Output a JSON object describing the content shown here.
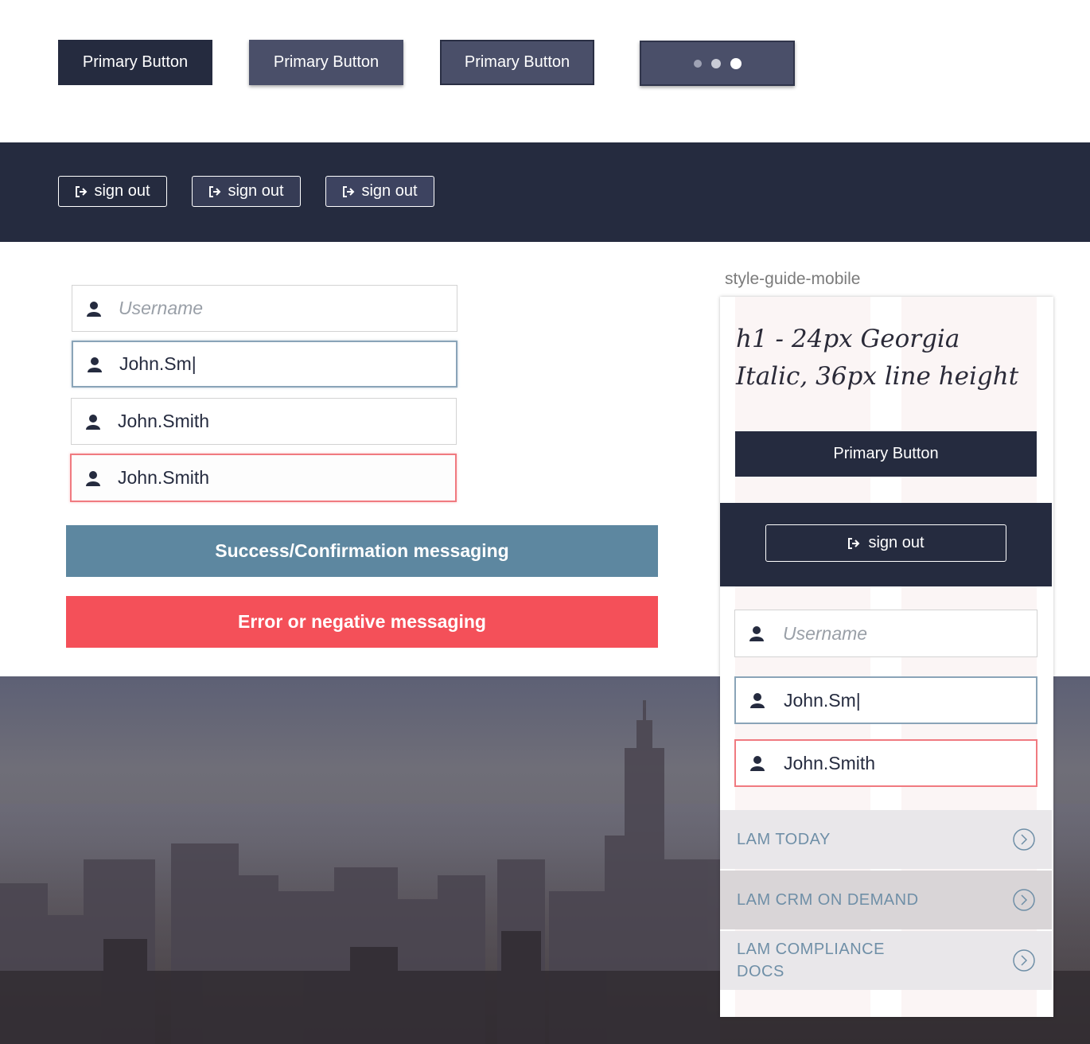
{
  "top_buttons": [
    {
      "label": "Primary Button",
      "state": "normal"
    },
    {
      "label": "Primary Button",
      "state": "hover"
    },
    {
      "label": "Primary Button",
      "state": "active"
    }
  ],
  "loading_button": {
    "dots": 3
  },
  "signout_buttons": [
    {
      "label": "sign out"
    },
    {
      "label": "sign out"
    },
    {
      "label": "sign out"
    }
  ],
  "inputs": [
    {
      "placeholder": "Username",
      "value": ""
    },
    {
      "value": "John.Sm|"
    },
    {
      "value": "John.Smith"
    },
    {
      "value": "John.Smith"
    }
  ],
  "messages": {
    "success": "Success/Confirmation messaging",
    "error": "Error or negative messaging"
  },
  "mobile": {
    "label": "style-guide-mobile",
    "h1": "h1 - 24px Georgia Italic, 36px line height",
    "primary_button": "Primary Button",
    "signout": "sign out",
    "inputs": [
      {
        "placeholder": "Username"
      },
      {
        "value": "John.Sm|"
      },
      {
        "value": "John.Smith"
      }
    ],
    "nav": [
      {
        "label": "LAM TODAY"
      },
      {
        "label": "LAM CRM ON DEMAND"
      },
      {
        "label": "LAM COMPLIANCE DOCS"
      }
    ]
  },
  "colors": {
    "navy": "#252b3f",
    "success": "#5d87a0",
    "error": "#f45059",
    "nav_text": "#6f8fa7"
  },
  "icons": [
    "user-icon",
    "sign-out-icon",
    "chevron-right-circle-icon"
  ]
}
